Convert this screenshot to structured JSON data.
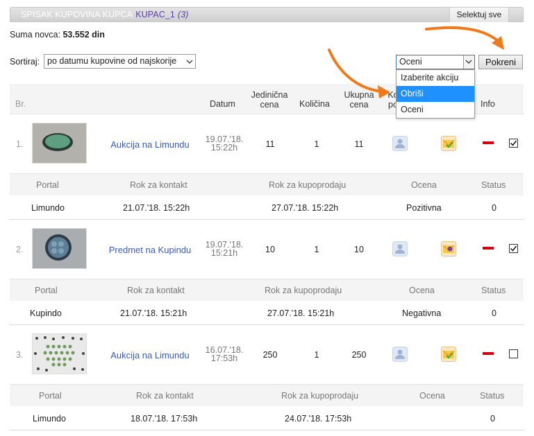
{
  "header": {
    "title": "SPISAK KUPOVINA KUPCA",
    "buyer": "KUPAC_1",
    "count": "(3)",
    "select_all": "Selektuj sve"
  },
  "summary": {
    "label": "Suma novca:",
    "value": "53.552 din"
  },
  "sort": {
    "label": "Sortiraj:",
    "value": "po datumu kupovine od najskorije"
  },
  "action": {
    "value": "Oceni",
    "run_label": "Pokreni",
    "options": [
      "Izaberite akciju",
      "Obriši",
      "Oceni"
    ]
  },
  "columns": {
    "br": "Br.",
    "datum": "Datum",
    "unit_price_1": "Jedinična",
    "unit_price_2": "cena",
    "quantity": "Količina",
    "total_1": "Ukupna",
    "total_2": "cena",
    "contact_1": "Ko",
    "contact_2": "po",
    "info": "Info"
  },
  "sub_columns": [
    "Portal",
    "Rok za kontakt",
    "Rok za kupoprodaju",
    "Ocena",
    "Status"
  ],
  "items": [
    {
      "num": "1.",
      "title": "Aukcija na Limundu",
      "date1": "19.07.'18.",
      "date2": "15:22h",
      "unit_price": "11",
      "quantity": "1",
      "total": "11",
      "checked": true,
      "portal": "Limundo",
      "contact_deadline": "21.07.'18. 15:22h",
      "sale_deadline": "27.07.'18. 15:22h",
      "rating": "Pozitivna",
      "status": "0"
    },
    {
      "num": "2.",
      "title": "Predmet na Kupindu",
      "date1": "19.07.'18.",
      "date2": "15:21h",
      "unit_price": "10",
      "quantity": "1",
      "total": "10",
      "checked": true,
      "portal": "Kupindo",
      "contact_deadline": "21.07.'18. 15:21h",
      "sale_deadline": "27.07.'18. 15:21h",
      "rating": "Negativna",
      "status": "0"
    },
    {
      "num": "3.",
      "title": "Aukcija na Limundu",
      "date1": "16.07.'18.",
      "date2": "17:53h",
      "unit_price": "250",
      "quantity": "1",
      "total": "250",
      "checked": false,
      "portal": "Limundo",
      "contact_deadline": "18.07.'18. 17:53h",
      "sale_deadline": "24.07.'18. 17:53h",
      "rating": "",
      "status": "0"
    }
  ],
  "colors": {
    "accent": "#3a5ab8",
    "arrow": "#f07a1a",
    "remove": "#d9000d",
    "highlight": "#1e90ff"
  }
}
